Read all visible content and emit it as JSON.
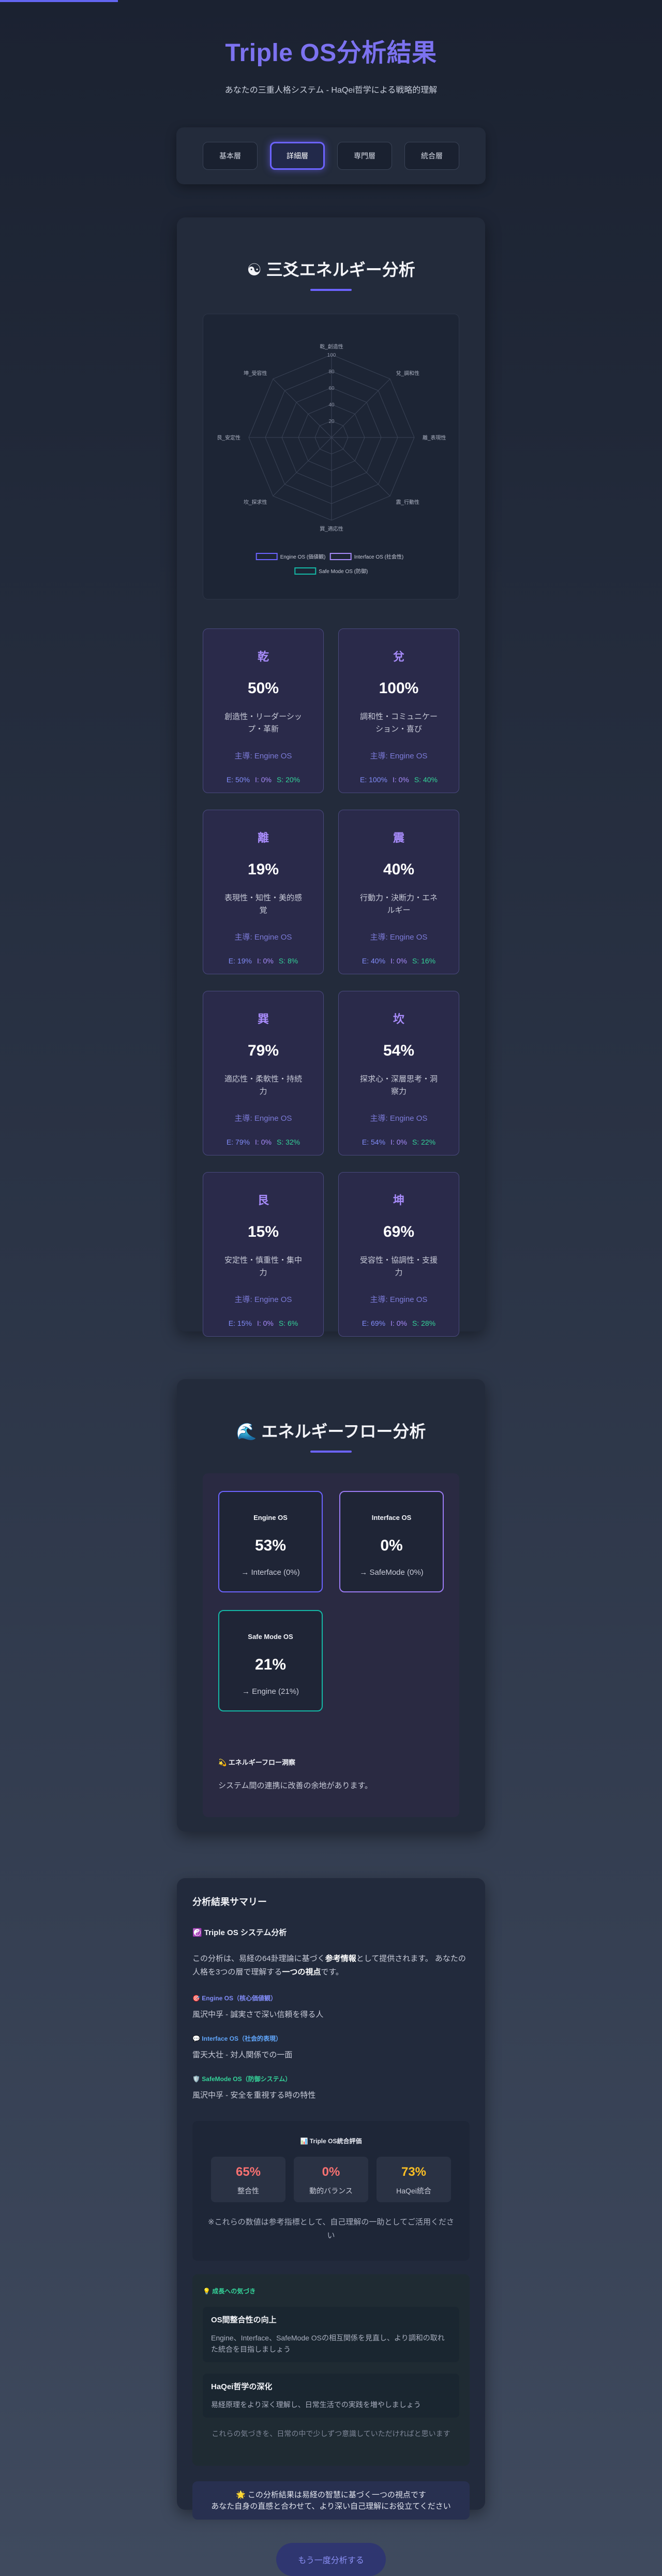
{
  "header": {
    "title": "Triple OS分析結果",
    "subtitle": "あなたの三重人格システム - HaQei哲学による戦略的理解"
  },
  "tabs": [
    {
      "label": "基本層",
      "active": false
    },
    {
      "label": "詳細層",
      "active": true
    },
    {
      "label": "専門層",
      "active": false
    },
    {
      "label": "統合層",
      "active": false
    }
  ],
  "energy": {
    "icon": "☯",
    "title": "三爻エネルギー分析",
    "radar": {
      "axis_labels": [
        "乾_創造性",
        "兌_調和性",
        "離_表現性",
        "震_行動性",
        "巽_適応性",
        "坎_探求性",
        "艮_安定性",
        "坤_受容性"
      ],
      "ticks": [
        "100",
        "80",
        "60",
        "40",
        "20",
        "0"
      ],
      "legend": [
        {
          "name": "Engine OS (価値観)",
          "color": "#6c63ff"
        },
        {
          "name": "Interface OS (社会性)",
          "color": "#a78bfa"
        },
        {
          "name": "Safe Mode OS (防御)",
          "color": "#14b8a6"
        }
      ]
    },
    "trigrams": [
      {
        "name": "乾",
        "percent": "50%",
        "desc": "創造性・リーダーシップ・革新",
        "main": "主導: Engine OS",
        "e": "E: 50%",
        "i": "I: 0%",
        "s": "S: 20%"
      },
      {
        "name": "兌",
        "percent": "100%",
        "desc": "調和性・コミュニケーション・喜び",
        "main": "主導: Engine OS",
        "e": "E: 100%",
        "i": "I: 0%",
        "s": "S: 40%"
      },
      {
        "name": "離",
        "percent": "19%",
        "desc": "表現性・知性・美的感覚",
        "main": "主導: Engine OS",
        "e": "E: 19%",
        "i": "I: 0%",
        "s": "S: 8%"
      },
      {
        "name": "震",
        "percent": "40%",
        "desc": "行動力・決断力・エネルギー",
        "main": "主導: Engine OS",
        "e": "E: 40%",
        "i": "I: 0%",
        "s": "S: 16%"
      },
      {
        "name": "巽",
        "percent": "79%",
        "desc": "適応性・柔軟性・持続力",
        "main": "主導: Engine OS",
        "e": "E: 79%",
        "i": "I: 0%",
        "s": "S: 32%"
      },
      {
        "name": "坎",
        "percent": "54%",
        "desc": "探求心・深層思考・洞察力",
        "main": "主導: Engine OS",
        "e": "E: 54%",
        "i": "I: 0%",
        "s": "S: 22%"
      },
      {
        "name": "艮",
        "percent": "15%",
        "desc": "安定性・慎重性・集中力",
        "main": "主導: Engine OS",
        "e": "E: 15%",
        "i": "I: 0%",
        "s": "S: 6%"
      },
      {
        "name": "坤",
        "percent": "69%",
        "desc": "受容性・協調性・支援力",
        "main": "主導: Engine OS",
        "e": "E: 69%",
        "i": "I: 0%",
        "s": "S: 28%"
      }
    ]
  },
  "flow": {
    "icon": "🌊",
    "title": "エネルギーフロー分析",
    "boxes": [
      {
        "label": "Engine OS",
        "percent": "53%",
        "to": "→ Interface (0%)",
        "kind": "engine"
      },
      {
        "label": "Interface OS",
        "percent": "0%",
        "to": "→ SafeMode (0%)",
        "kind": "interface"
      },
      {
        "label": "Safe Mode OS",
        "percent": "21%",
        "to": "→ Engine (21%)",
        "kind": "safemode"
      }
    ],
    "detail_title": "💫 エネルギーフロー洞察",
    "detail_text": "システム間の連携に改善の余地があります。"
  },
  "summary": {
    "title": "分析結果サマリー",
    "os_heading": "☯️ Triple OS システム分析",
    "desc_1": "この分析は、易経の64卦理論に基づく",
    "desc_bold_1": "参考情報",
    "desc_2": "として提供されます。 あなたの人格を3つの層で理解する",
    "desc_bold_2": "一つの視点",
    "desc_3": "です。",
    "engine_label": "🎯 Engine OS（核心価値観）",
    "engine_text": "風沢中孚 - 誠実さで深い信頼を得る人",
    "interface_label": "💬 Interface OS（社会的表現）",
    "interface_text": "雷天大壮 - 対人関係での一面",
    "safemode_label": "🛡️ SafeMode OS（防御システム）",
    "safemode_text": "風沢中孚 - 安全を重視する時の特性",
    "metrics_title": "📊 Triple OS統合評価",
    "metrics": [
      {
        "value": "65%",
        "label": "整合性",
        "color": "#f87171"
      },
      {
        "value": "0%",
        "label": "動的バランス",
        "color": "#f87171"
      },
      {
        "value": "73%",
        "label": "HaQei統合",
        "color": "#fbbf24"
      }
    ],
    "metrics_note": "※これらの数値は参考指標として、自己理解の一助としてご活用ください",
    "growth_title": "💡 成長への気づき",
    "growth_items": [
      {
        "title": "OS間整合性の向上",
        "text": "Engine、Interface、SafeMode OSの相互関係を見直し、より調和の取れた統合を目指しましょう"
      },
      {
        "title": "HaQei哲学の深化",
        "text": "易経原理をより深く理解し、日常生活での実践を増やしましょう"
      }
    ],
    "growth_foot": "これらの気づきを、日常の中で少しずつ意識していただければと思います",
    "closing_1": "🌟 この分析結果は易経の智慧に基づく一つの視点です",
    "closing_2": "あなた自身の直感と合わせて、より深い自己理解にお役立てください"
  },
  "again_button": "もう一度分析する"
}
